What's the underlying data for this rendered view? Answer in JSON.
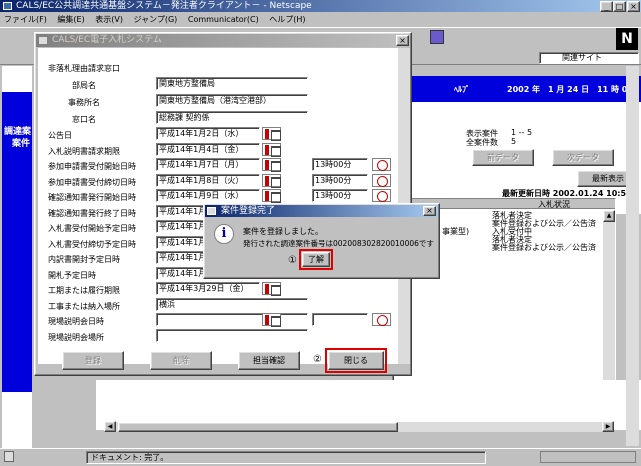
{
  "browser": {
    "title": "CALS/EC公共調達共通基盤システム－発注者クライアント－ - Netscape",
    "menu": [
      "ファイル(F)",
      "編集(E)",
      "表示(V)",
      "ジャンプ(G)",
      "Communicator(C)",
      "ヘルプ(H)"
    ],
    "related_sites": "関連サイト",
    "status_text": "ドキュメント: 完了。"
  },
  "portal": {
    "help": "ﾍﾙﾌﾟ",
    "datetime": "2002 年　1 月 24 日　11 時 0 分",
    "left_title_1": "調達案",
    "left_title_2": "案件",
    "display_count_label": "表示案件",
    "display_count_value": "1 -- 5",
    "total_count_label": "全案件数",
    "total_count_value": "5",
    "prev_button": "前データ",
    "next_button": "次データ",
    "latest_button": "最新表示",
    "last_update": "最新更新日時 2002.01.24 10:51",
    "table_header": "入札状況",
    "rows": [
      {
        "mid": "",
        "status": "落札者決定"
      },
      {
        "mid": "",
        "status": "案件登録および公示／公告済"
      },
      {
        "mid": "事業型)",
        "status": "入札受付中"
      },
      {
        "mid": "",
        "status": "落札者決定"
      },
      {
        "mid": "",
        "status": "案件登録および公示／公告済"
      }
    ]
  },
  "ebid": {
    "title": "CALS/EC電子入札システム",
    "section": "非落札理由請求窓口",
    "office_label": "部局名",
    "office_value": "関東地方整備局",
    "branch_label": "事務所名",
    "branch_value": "関東地方整備局（港湾空港部）",
    "window_label": "窓口名",
    "window_value": "総務課 契約係",
    "rows": [
      {
        "label": "公告日",
        "date": "平成14年1月2日（水）",
        "time": "",
        "cal": true,
        "clk": false
      },
      {
        "label": "入札説明書請求期限",
        "date": "平成14年1月4日（金）",
        "time": "",
        "cal": true,
        "clk": false
      },
      {
        "label": "参加申請書受付開始日時",
        "date": "平成14年1月7日（月）",
        "time": "13時00分",
        "cal": true,
        "clk": true
      },
      {
        "label": "参加申請書受付締切日時",
        "date": "平成14年1月8日（火）",
        "time": "13時00分",
        "cal": true,
        "clk": true
      },
      {
        "label": "確認通知書発行開始日時",
        "date": "平成14年1月9日（水）",
        "time": "13時00分",
        "cal": true,
        "clk": true
      },
      {
        "label": "確認通知書発行終了日時",
        "date": "平成14年1月",
        "time": "",
        "cal": false,
        "clk": false
      },
      {
        "label": "入札書受付開始予定日時",
        "date": "平成14年1月",
        "time": "",
        "cal": false,
        "clk": false
      },
      {
        "label": "入札書受付締切予定日時",
        "date": "平成14年1月",
        "time": "",
        "cal": false,
        "clk": false
      },
      {
        "label": "内訳書開封予定日時",
        "date": "平成14年1月",
        "time": "",
        "cal": false,
        "clk": false
      },
      {
        "label": "開札予定日時",
        "date": "平成14年1月",
        "time": "",
        "cal": false,
        "clk": false
      },
      {
        "label": "工期または履行期限",
        "date": "平成14年3月29日（金）",
        "time": "",
        "cal": true,
        "clk": false
      },
      {
        "label": "工事または納入場所",
        "date": "横浜",
        "time": "",
        "cal": false,
        "clk": false
      },
      {
        "label": "現場説明会日時",
        "date": "",
        "time": "",
        "cal": true,
        "clk": true
      },
      {
        "label": "現場説明会場所",
        "date": "",
        "time": "",
        "cal": false,
        "clk": false
      }
    ],
    "register_button": "登録",
    "delete_button": "削除",
    "confirm_button": "担当確認",
    "step2": "②",
    "close_button": "閉じる"
  },
  "dialog": {
    "title": "案件登録完了",
    "message1": "案件を登録しました。",
    "message2": "発行された調達案件番号は0020083028200100​06です",
    "step1": "①",
    "ok_button": "了解"
  }
}
